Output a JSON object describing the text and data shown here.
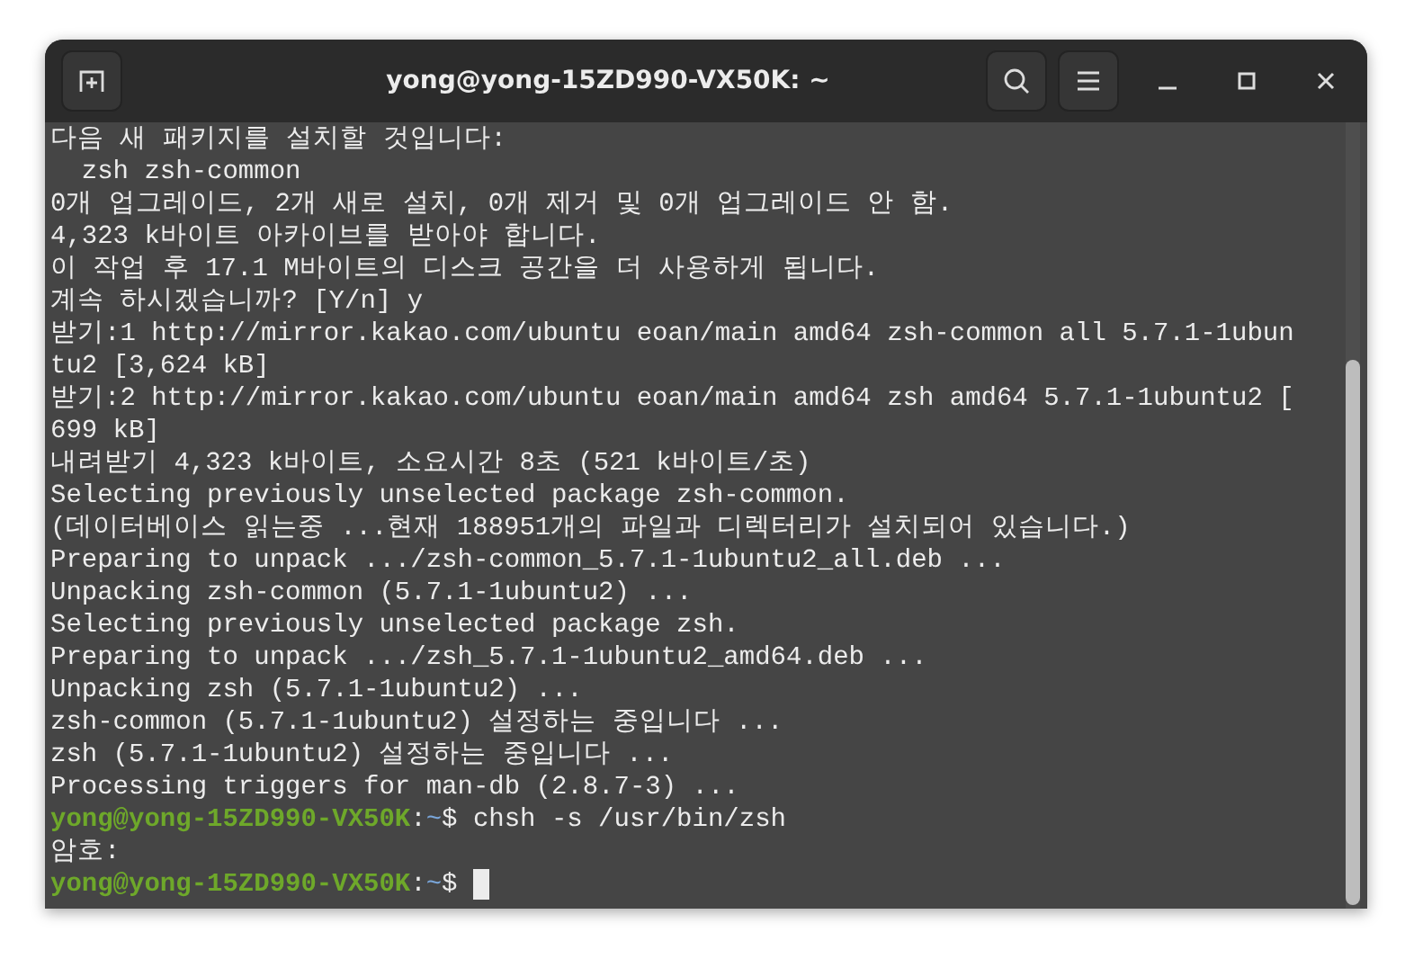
{
  "window": {
    "title": "yong@yong-15ZD990-VX50K: ~"
  },
  "terminal": {
    "lines": [
      {
        "kind": "output",
        "text": "다음 새 패키지를 설치할 것입니다:"
      },
      {
        "kind": "output",
        "text": "  zsh zsh-common"
      },
      {
        "kind": "output",
        "text": "0개 업그레이드, 2개 새로 설치, 0개 제거 및 0개 업그레이드 안 함."
      },
      {
        "kind": "output",
        "text": "4,323 k바이트 아카이브를 받아야 합니다."
      },
      {
        "kind": "output",
        "text": "이 작업 후 17.1 M바이트의 디스크 공간을 더 사용하게 됩니다."
      },
      {
        "kind": "output",
        "text": "계속 하시겠습니까? [Y/n] y"
      },
      {
        "kind": "output",
        "text": "받기:1 http://mirror.kakao.com/ubuntu eoan/main amd64 zsh-common all 5.7.1-1ubun"
      },
      {
        "kind": "output",
        "text": "tu2 [3,624 kB]"
      },
      {
        "kind": "output",
        "text": "받기:2 http://mirror.kakao.com/ubuntu eoan/main amd64 zsh amd64 5.7.1-1ubuntu2 ["
      },
      {
        "kind": "output",
        "text": "699 kB]"
      },
      {
        "kind": "output",
        "text": "내려받기 4,323 k바이트, 소요시간 8초 (521 k바이트/초)"
      },
      {
        "kind": "output",
        "text": "Selecting previously unselected package zsh-common."
      },
      {
        "kind": "output",
        "text": "(데이터베이스 읽는중 ...현재 188951개의 파일과 디렉터리가 설치되어 있습니다.)"
      },
      {
        "kind": "output",
        "text": "Preparing to unpack .../zsh-common_5.7.1-1ubuntu2_all.deb ..."
      },
      {
        "kind": "output",
        "text": "Unpacking zsh-common (5.7.1-1ubuntu2) ..."
      },
      {
        "kind": "output",
        "text": "Selecting previously unselected package zsh."
      },
      {
        "kind": "output",
        "text": "Preparing to unpack .../zsh_5.7.1-1ubuntu2_amd64.deb ..."
      },
      {
        "kind": "output",
        "text": "Unpacking zsh (5.7.1-1ubuntu2) ..."
      },
      {
        "kind": "output",
        "text": "zsh-common (5.7.1-1ubuntu2) 설정하는 중입니다 ..."
      },
      {
        "kind": "output",
        "text": "zsh (5.7.1-1ubuntu2) 설정하는 중입니다 ..."
      },
      {
        "kind": "output",
        "text": "Processing triggers for man-db (2.8.7-3) ..."
      },
      {
        "kind": "prompt",
        "host": "yong@yong-15ZD990-VX50K",
        "sep": ":",
        "path": "~",
        "sign": "$",
        "command": "chsh -s /usr/bin/zsh",
        "cursor": false
      },
      {
        "kind": "output",
        "text": "암호:"
      },
      {
        "kind": "prompt",
        "host": "yong@yong-15ZD990-VX50K",
        "sep": ":",
        "path": "~",
        "sign": "$",
        "cursor": true
      }
    ]
  }
}
